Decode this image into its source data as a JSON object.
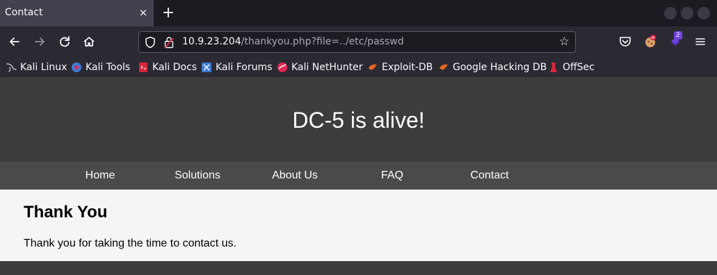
{
  "browser": {
    "tab": {
      "title": "Contact",
      "close": "×"
    },
    "new_tab": "+",
    "url": {
      "host": "10.9.23.204",
      "path": "/thankyou.php?file=../etc/passwd"
    },
    "extension_badge": "2",
    "bookmarks": [
      {
        "label": "Kali Linux",
        "icon": "kali-dragon-icon"
      },
      {
        "label": "Kali Tools",
        "icon": "kali-tools-icon"
      },
      {
        "label": "Kali Docs",
        "icon": "kali-docs-icon"
      },
      {
        "label": "Kali Forums",
        "icon": "kali-forums-icon"
      },
      {
        "label": "Kali NetHunter",
        "icon": "nethunter-icon"
      },
      {
        "label": "Exploit-DB",
        "icon": "exploit-db-icon"
      },
      {
        "label": "Google Hacking DB",
        "icon": "ghdb-icon"
      },
      {
        "label": "OffSec",
        "icon": "offsec-icon"
      }
    ]
  },
  "site": {
    "title": "DC-5 is alive!",
    "menu": [
      "Home",
      "Solutions",
      "About Us",
      "FAQ",
      "Contact"
    ],
    "heading": "Thank You",
    "message": "Thank you for taking the time to contact us."
  },
  "colors": {
    "header_bg": "#3d3d3d",
    "menu_bg": "#4a4a4a",
    "content_bg": "#f5f5f5"
  }
}
